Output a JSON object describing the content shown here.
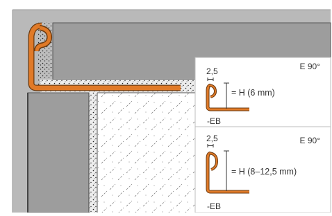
{
  "colors": {
    "background": "#ffffff",
    "frame": "#b9b9b9",
    "tile": "#9d9d9d",
    "tile_stroke": "#555555",
    "mortar": "#ededed",
    "dark_edge": "#5a5a5a",
    "profile": "#e07a28",
    "profile_outline": "#6a3a10",
    "panel": "#ffffff",
    "panel_border": "#bdbdbd",
    "text": "#333333"
  },
  "panels": [
    {
      "thickness_label": "2,5",
      "finish_label": "E 90°",
      "height_label": "= H (6 mm)",
      "suffix_label": "-EB"
    },
    {
      "thickness_label": "2,5",
      "finish_label": "E 90°",
      "height_label": "= H (8–12,5 mm)",
      "suffix_label": "-EB"
    }
  ]
}
